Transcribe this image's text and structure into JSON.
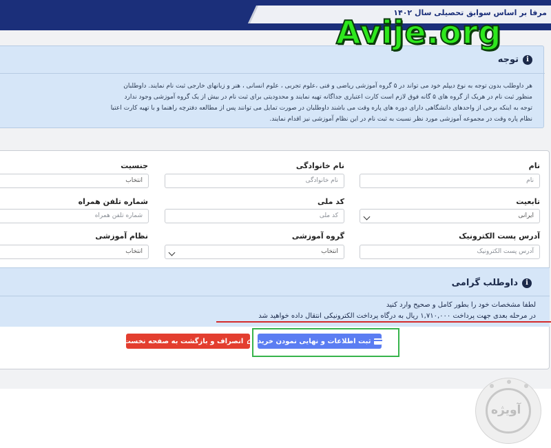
{
  "header": {
    "title": "مرفا بر اساس سوابق تحصیلی سال ۱۴۰۲"
  },
  "watermark": {
    "brand": "Avije.org",
    "logo_text": "آویژه"
  },
  "notice": {
    "title": "توجه",
    "lines": [
      "هر داوطلب بدون توجه به نوع دیپلم خود می تواند در ۵ گروه آموزشی ریاضی و فنی ،علوم تجربی ، علوم انسانی ، هنر و زبانهای خارجی ثبت نام نمایند. داوطلبان",
      "منظور ثبت نام در هریک از گروه های ۵ گانه فوق لازم است کارت اعتباری جداگانه تهیه نمایند و محدودیتی برای ثبت نام در بیش از یک گروه آموزشی وجود ندارد",
      "توجه به اینکه برخی از واحدهای دانشگاهی دارای دوره های پاره وقت می باشند داوطلبان در صورت تمایل می توانند پس از مطالعه دفترچه راهنما و با تهیه کارت اعتبا",
      "نظام پاره وقت در مجموعه آموزشی مورد نظر نسبت به ثبت نام در این نظام آموزشی نیز اقدام نمایند."
    ]
  },
  "form": {
    "row1": {
      "first_name": {
        "label": "نام",
        "placeholder": "نام"
      },
      "last_name": {
        "label": "نام خانوادگی",
        "placeholder": "نام خانوادگی"
      },
      "gender": {
        "label": "جنسیت",
        "value": "انتخاب"
      }
    },
    "row2": {
      "nationality": {
        "label": "تابعیت",
        "value": "ایرانی"
      },
      "national_code": {
        "label": "کد ملی",
        "placeholder": "کد ملی"
      },
      "mobile": {
        "label": "شماره تلفن همراه",
        "placeholder": "شماره تلفن همراه"
      }
    },
    "row3": {
      "email": {
        "label": "آدرس پست الکترونیک",
        "placeholder": "آدرس پست الکترونیک"
      },
      "education_group": {
        "label": "گروه آموزشی",
        "value": "انتخاب"
      },
      "education_system": {
        "label": "نظام آموزشی",
        "value": "انتخاب"
      }
    }
  },
  "applicant": {
    "title": "داوطلب گرامی",
    "line1": "لطفا مشخصات خود را بطور کامل و صحیح وارد کنید",
    "line2": "در مرحله بعدی جهت پرداخت ۱,۷۱۰,۰۰۰ ریال به درگاه پرداخت الکترونیکی انتقال داده خواهید شد"
  },
  "buttons": {
    "submit": "ثبت اطلاعات و نهایی نمودن خرید",
    "cancel": "انصراف و بازگشت به صفحه نخست"
  }
}
